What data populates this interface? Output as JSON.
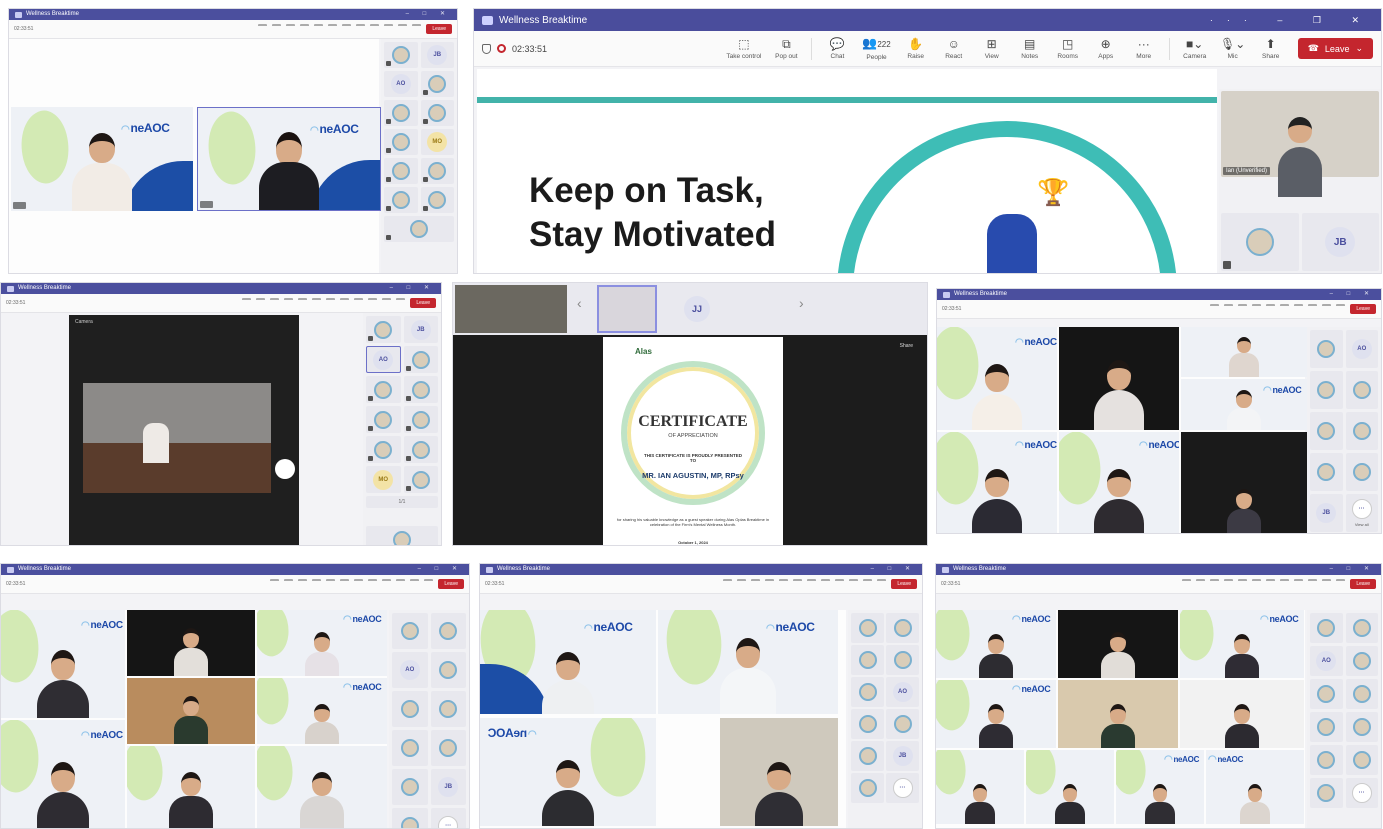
{
  "app": {
    "window_title": "Wellness Breaktime",
    "timer": "02:33:51",
    "leave_label": "Leave",
    "accent": "#4b4f9e",
    "leave_color": "#c4262e"
  },
  "toolbar": [
    {
      "label": "Take control",
      "icon": "take-control-icon"
    },
    {
      "label": "Pop out",
      "icon": "pop-out-icon"
    },
    {
      "label": "Chat",
      "icon": "chat-icon"
    },
    {
      "label": "People",
      "icon": "people-icon",
      "count": "222"
    },
    {
      "label": "Raise",
      "icon": "raise-hand-icon"
    },
    {
      "label": "React",
      "icon": "react-icon"
    },
    {
      "label": "View",
      "icon": "view-icon"
    },
    {
      "label": "Notes",
      "icon": "notes-icon"
    },
    {
      "label": "Rooms",
      "icon": "rooms-icon"
    },
    {
      "label": "Apps",
      "icon": "apps-icon"
    },
    {
      "label": "More",
      "icon": "more-icon"
    },
    {
      "label": "Camera",
      "icon": "camera-icon"
    },
    {
      "label": "Mic",
      "icon": "mic-icon"
    },
    {
      "label": "Share",
      "icon": "share-icon"
    }
  ],
  "slide": {
    "line1": "Keep on Task,",
    "line2": "Stay Motivated",
    "presenter_name": "Ian (Unverified)"
  },
  "brand": {
    "logo_text": "neAOC"
  },
  "initials": [
    "AO",
    "JB",
    "MO",
    "JJ"
  ],
  "certificate": {
    "title": "CERTIFICATE",
    "subtitle": "OF APPRECIATION",
    "presented": "THIS CERTIFICATE IS PROUDLY PRESENTED TO",
    "recipient": "MR. IAN AGUSTIN, MP, RPsy",
    "body": "for sharing his valuable knowledge as a guest speaker during Alas Oplas Breaktime in celebration of the Firm's Mental Wellness Month.",
    "date": "October 1, 2024",
    "brand": "Alas",
    "share_label": "Share",
    "camera_label": "Camera"
  },
  "page_info": "1/1",
  "view_all": "View all"
}
